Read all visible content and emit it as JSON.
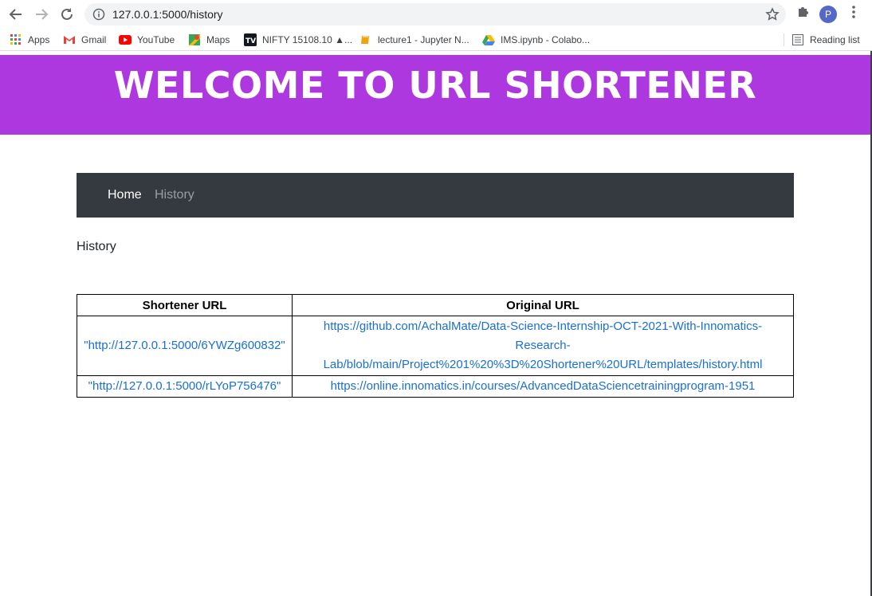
{
  "browser": {
    "url": "127.0.0.1:5000/history",
    "profile_initial": "P"
  },
  "bookmarks": {
    "items": [
      {
        "label": "Apps",
        "icon": "apps-grid-icon"
      },
      {
        "label": "Gmail",
        "icon": "gmail-icon"
      },
      {
        "label": "YouTube",
        "icon": "youtube-icon"
      },
      {
        "label": "Maps",
        "icon": "maps-icon"
      },
      {
        "label": "NIFTY 15108.10 ▲...",
        "icon": "tradingview-icon"
      },
      {
        "label": "lecture1 - Jupyter N...",
        "icon": "notebook-icon"
      },
      {
        "label": "IMS.ipynb - Colabo...",
        "icon": "google-drive-icon"
      }
    ],
    "reading_list": "Reading list"
  },
  "header": {
    "title": "WELCOME TO URL SHORTENER",
    "bg_color": "#ad38e0"
  },
  "nav": {
    "home": "Home",
    "history": "History"
  },
  "main": {
    "title": "History",
    "table": {
      "columns": [
        "Shortener URL",
        "Original URL"
      ],
      "rows": [
        {
          "short": "\"http://127.0.0.1:5000/6YWZg600832\"",
          "original": "https://github.com/AchalMate/Data-Science-Internship-OCT-2021-With-Innomatics-Research-Lab/blob/main/Project%201%20%3D%20Shortener%20URL/templates/history.html"
        },
        {
          "short": "\"http://127.0.0.1:5000/rLYoP756476\"",
          "original": "https://online.innomatics.in/courses/AdvancedDataSciencetrainingprogram-1951"
        }
      ]
    }
  },
  "colors": {
    "navbar": "#343a40",
    "link": "#1a6fd6"
  }
}
